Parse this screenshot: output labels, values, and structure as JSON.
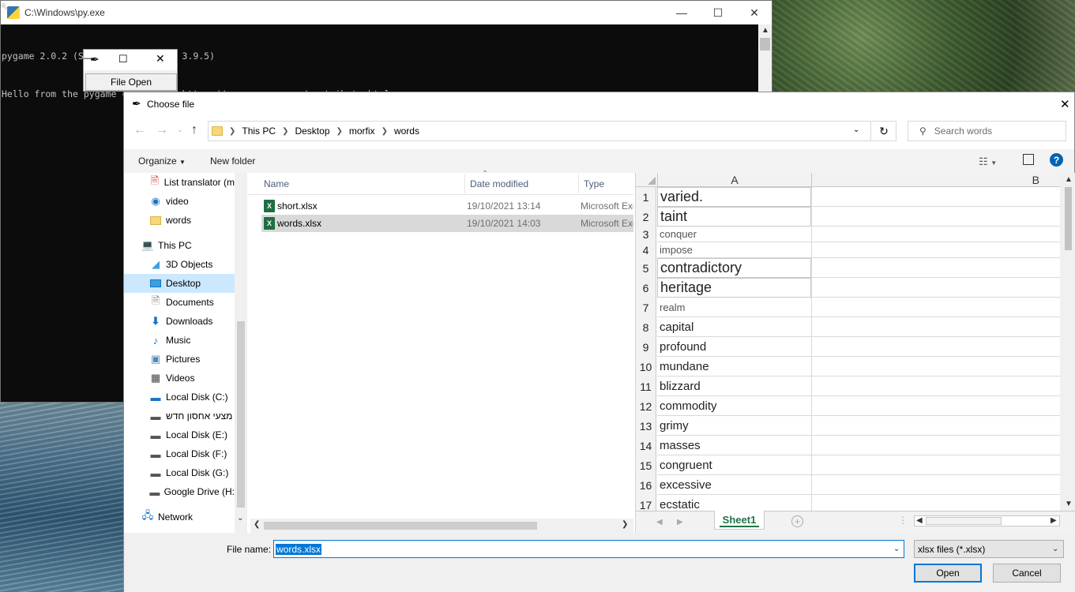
{
  "console": {
    "title": "C:\\Windows\\py.exe",
    "lines": [
      "pygame 2.0.2 (SDL 2.0.16, Python 3.9.5)",
      "Hello from the pygame community. https://www.pygame.org/contribute.html"
    ]
  },
  "tk_window": {
    "button_label": "File Open"
  },
  "dialog": {
    "title": "Choose file",
    "breadcrumbs": [
      "This PC",
      "Desktop",
      "morfix",
      "words"
    ],
    "search_placeholder": "Search words",
    "toolbar": {
      "organize": "Organize",
      "new_folder": "New folder"
    },
    "nav_items": [
      {
        "label": "List translator (m",
        "icon": "file-icon"
      },
      {
        "label": "video",
        "icon": "video-folder-icon"
      },
      {
        "label": "words",
        "icon": "folder-icon"
      },
      {
        "label": "This PC",
        "icon": "computer-icon"
      },
      {
        "label": "3D Objects",
        "icon": "cube-icon"
      },
      {
        "label": "Desktop",
        "icon": "desktop-icon"
      },
      {
        "label": "Documents",
        "icon": "documents-icon"
      },
      {
        "label": "Downloads",
        "icon": "download-icon"
      },
      {
        "label": "Music",
        "icon": "music-icon"
      },
      {
        "label": "Pictures",
        "icon": "pictures-icon"
      },
      {
        "label": "Videos",
        "icon": "videos-icon"
      },
      {
        "label": "Local Disk (C:)",
        "icon": "drive-icon"
      },
      {
        "label": "מצעי אחסון חדש",
        "icon": "drive-icon"
      },
      {
        "label": "Local Disk (E:)",
        "icon": "drive-icon"
      },
      {
        "label": "Local Disk (F:)",
        "icon": "drive-icon"
      },
      {
        "label": "Local Disk (G:)",
        "icon": "drive-icon"
      },
      {
        "label": "Google Drive (H:",
        "icon": "drive-icon"
      },
      {
        "label": "Network",
        "icon": "network-icon"
      }
    ],
    "columns": {
      "name": "Name",
      "date": "Date modified",
      "type": "Type"
    },
    "files": [
      {
        "name": "short.xlsx",
        "date": "19/10/2021 13:14",
        "type": "Microsoft Excel"
      },
      {
        "name": "words.xlsx",
        "date": "19/10/2021 14:03",
        "type": "Microsoft Excel"
      }
    ],
    "preview": {
      "col_a": "A",
      "col_b": "B",
      "rows": [
        {
          "n": "1",
          "v": "varied."
        },
        {
          "n": "2",
          "v": "taint"
        },
        {
          "n": "3",
          "v": "conquer"
        },
        {
          "n": "4",
          "v": "impose"
        },
        {
          "n": "5",
          "v": "contradictory"
        },
        {
          "n": "6",
          "v": "heritage"
        },
        {
          "n": "7",
          "v": "realm"
        },
        {
          "n": "8",
          "v": "capital"
        },
        {
          "n": "9",
          "v": "profound"
        },
        {
          "n": "10",
          "v": "mundane"
        },
        {
          "n": "11",
          "v": "blizzard"
        },
        {
          "n": "12",
          "v": "commodity"
        },
        {
          "n": "13",
          "v": "grimy"
        },
        {
          "n": "14",
          "v": "masses"
        },
        {
          "n": "15",
          "v": "congruent"
        },
        {
          "n": "16",
          "v": "excessive"
        },
        {
          "n": "17",
          "v": "ecstatic"
        }
      ],
      "sheet_tab": "Sheet1"
    },
    "file_name_label": "File name:",
    "file_name_value": "words.xlsx",
    "file_type": "xlsx files (*.xlsx)",
    "open_label": "Open",
    "cancel_label": "Cancel"
  }
}
